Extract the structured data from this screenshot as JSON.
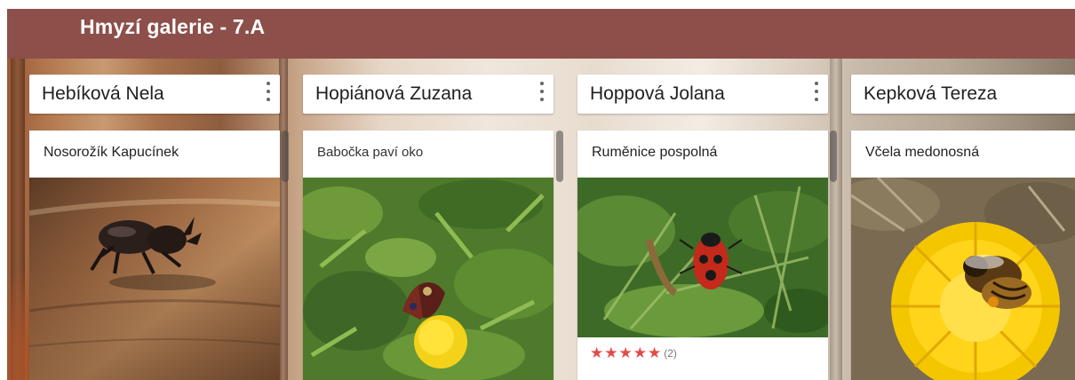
{
  "header": {
    "title": "Hmyzí galerie - 7.A"
  },
  "columns": [
    {
      "name": "Hebíková Nela",
      "card_title": "Nosorožík Kapucínek"
    },
    {
      "name": "Hopiánová Zuzana",
      "card_title": "Babočka paví oko"
    },
    {
      "name": "Hoppová Jolana",
      "card_title": "Ruměnice pospolná",
      "rating": {
        "stars": 5,
        "count_text": "(2)"
      }
    },
    {
      "name": "Kepková Tereza",
      "card_title": "Včela medonosná"
    }
  ],
  "icons": {
    "column_menu": "more-vertical-icon",
    "star": "star-icon"
  },
  "colors": {
    "header_bg": "#8d4f4a",
    "star": "#e24a4a"
  }
}
